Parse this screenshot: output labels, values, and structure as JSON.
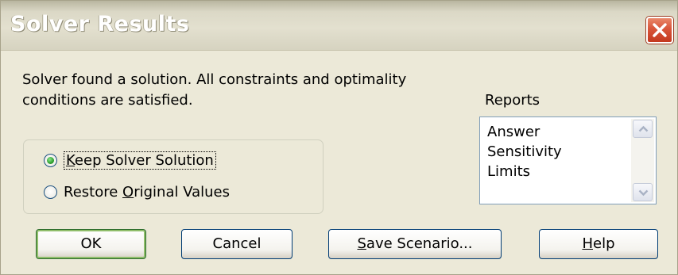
{
  "window": {
    "title": "Solver Results"
  },
  "message": {
    "line1": "Solver found a solution.  All constraints and optimality",
    "line2": "conditions are satisfied."
  },
  "options": [
    {
      "label_prefix": "",
      "label_underline": "K",
      "label_suffix": "eep Solver Solution",
      "checked": true
    },
    {
      "label_prefix": "Restore ",
      "label_underline": "O",
      "label_suffix": "riginal Values",
      "checked": false
    }
  ],
  "reports": {
    "label": "Reports",
    "items": [
      "Answer",
      "Sensitivity",
      "Limits"
    ]
  },
  "buttons": {
    "ok": "OK",
    "cancel": "Cancel",
    "save_underline": "S",
    "save_rest": "ave Scenario...",
    "help_underline": "H",
    "help_rest": "elp"
  },
  "icons": {
    "close": "close-icon",
    "scroll_up": "chevron-up-icon",
    "scroll_down": "chevron-down-icon"
  },
  "colors": {
    "dialog_bg": "#ece9d8",
    "close_button": "#d8553a",
    "selected_radio": "#2f9f2f",
    "default_button_ring": "#8fbd6a"
  }
}
